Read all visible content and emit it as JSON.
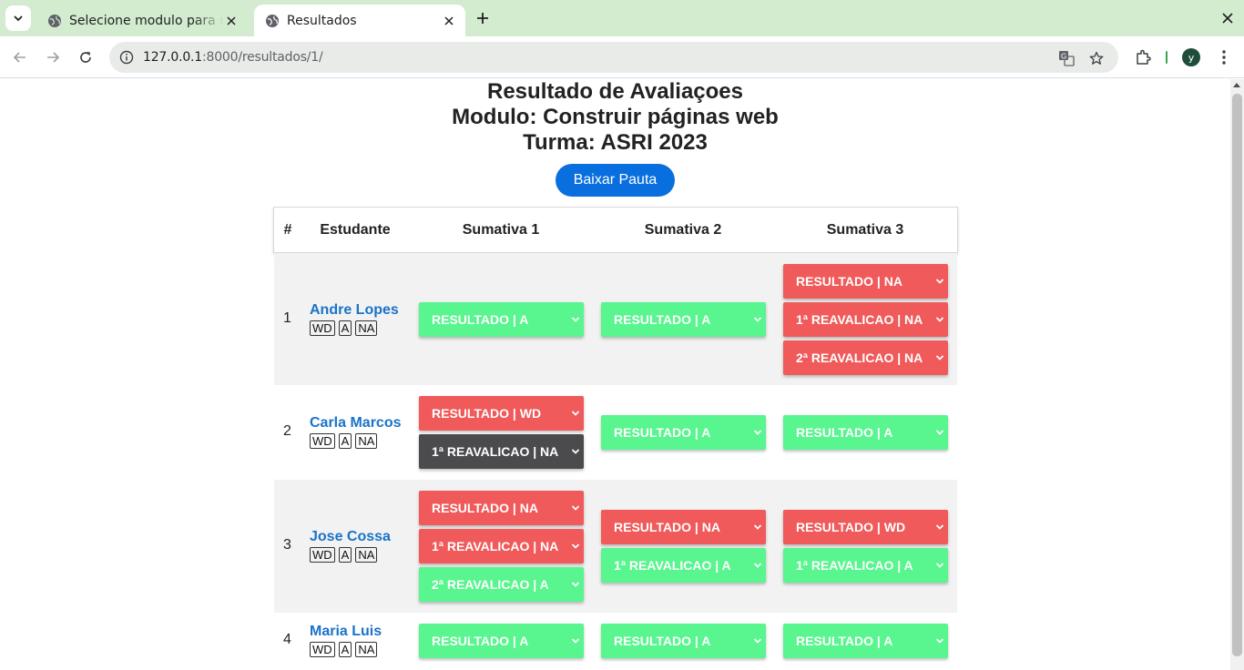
{
  "browser": {
    "tabs": [
      {
        "title": "Selecione modulo para m"
      },
      {
        "title": "Resultados"
      }
    ],
    "url_host": "127.0.0.1",
    "url_path": ":8000/resultados/1/",
    "profile_initial": "y"
  },
  "page": {
    "title_line1": "Resultado de Avaliaçoes",
    "title_line2": "Modulo: Construir páginas web",
    "title_line3": "Turma: ASRI 2023",
    "download_button": "Baixar Pauta"
  },
  "table": {
    "headers": [
      "#",
      "Estudante",
      "Sumativa 1",
      "Sumativa 2",
      "Sumativa 3"
    ],
    "badge_labels": [
      "WD",
      "A",
      "NA"
    ],
    "rows": [
      {
        "num": "1",
        "name": "Andre Lopes",
        "s1": [
          {
            "label": "RESULTADO | A",
            "color": "green"
          }
        ],
        "s2": [
          {
            "label": "RESULTADO | A",
            "color": "green"
          }
        ],
        "s3": [
          {
            "label": "RESULTADO | NA",
            "color": "red"
          },
          {
            "label": "1ª REAVALICAO | NA",
            "color": "red"
          },
          {
            "label": "2ª REAVALICAO | NA",
            "color": "red"
          }
        ]
      },
      {
        "num": "2",
        "name": "Carla Marcos",
        "s1": [
          {
            "label": "RESULTADO | WD",
            "color": "red"
          },
          {
            "label": "1ª REAVALICAO | NA",
            "color": "dark"
          }
        ],
        "s2": [
          {
            "label": "RESULTADO | A",
            "color": "green"
          }
        ],
        "s3": [
          {
            "label": "RESULTADO | A",
            "color": "green"
          }
        ]
      },
      {
        "num": "3",
        "name": "Jose Cossa",
        "s1": [
          {
            "label": "RESULTADO | NA",
            "color": "red"
          },
          {
            "label": "1ª REAVALICAO | NA",
            "color": "red"
          },
          {
            "label": "2ª REAVALICAO | A",
            "color": "green"
          }
        ],
        "s2": [
          {
            "label": "RESULTADO | NA",
            "color": "red"
          },
          {
            "label": "1ª REAVALICAO | A",
            "color": "green"
          }
        ],
        "s3": [
          {
            "label": "RESULTADO | WD",
            "color": "red"
          },
          {
            "label": "1ª REAVALICAO | A",
            "color": "green"
          }
        ]
      },
      {
        "num": "4",
        "name": "Maria Luis",
        "s1": [
          {
            "label": "RESULTADO | A",
            "color": "green"
          }
        ],
        "s2": [
          {
            "label": "RESULTADO | A",
            "color": "green"
          }
        ],
        "s3": [
          {
            "label": "RESULTADO | A",
            "color": "green"
          }
        ]
      }
    ]
  },
  "colors": {
    "green": "#59f58f",
    "red": "#f05a5a",
    "dark": "#4b4b4e",
    "link": "#1a73c8",
    "button": "#0a6fde"
  }
}
